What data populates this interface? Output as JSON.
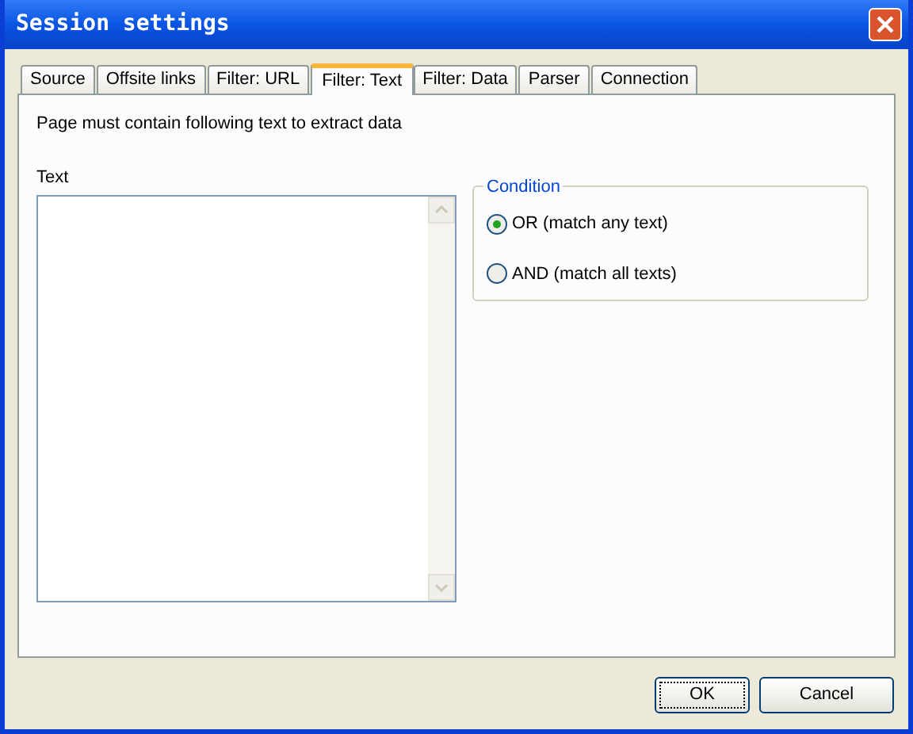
{
  "window": {
    "title": "Session settings"
  },
  "tabs": [
    {
      "label": "Source",
      "selected": false
    },
    {
      "label": "Offsite links",
      "selected": false
    },
    {
      "label": "Filter: URL",
      "selected": false
    },
    {
      "label": "Filter: Text",
      "selected": true
    },
    {
      "label": "Filter: Data",
      "selected": false
    },
    {
      "label": "Parser",
      "selected": false
    },
    {
      "label": "Connection",
      "selected": false
    }
  ],
  "description": "Page must contain following text to extract data",
  "text_field": {
    "label": "Text"
  },
  "condition": {
    "title": "Condition",
    "options": [
      {
        "label": "OR (match any text)",
        "selected": true
      },
      {
        "label": "AND (match all texts)",
        "selected": false
      }
    ]
  },
  "buttons": [
    {
      "label": "OK",
      "default": true
    },
    {
      "label": "Cancel",
      "default": false
    }
  ]
}
